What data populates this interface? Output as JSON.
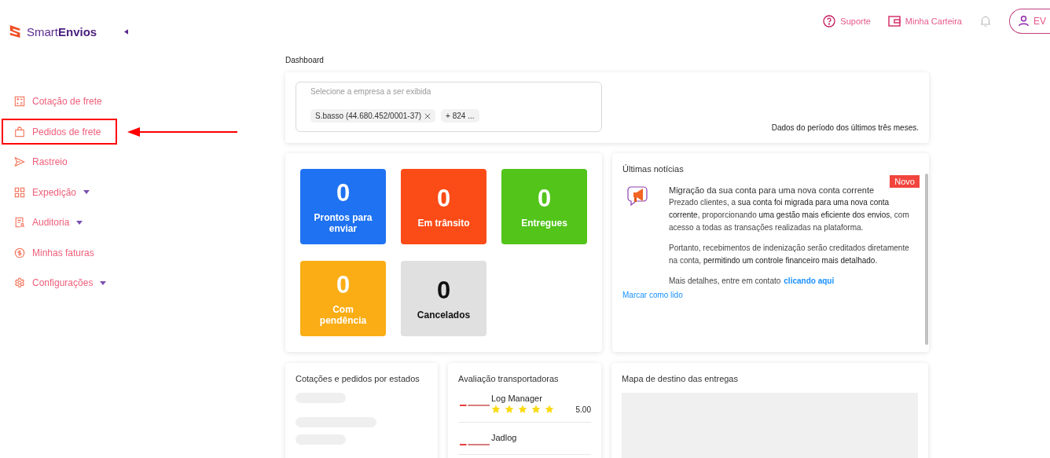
{
  "brand": {
    "name_light": "Smart",
    "name_bold": "Envios"
  },
  "header": {
    "support": "Suporte",
    "wallet": "Minha Carteira",
    "avatar": "EV"
  },
  "sidebar": {
    "items": [
      {
        "label": "Cotação de frete",
        "has_submenu": false,
        "highlighted": false
      },
      {
        "label": "Pedidos de frete",
        "has_submenu": false,
        "highlighted": true
      },
      {
        "label": "Rastreio",
        "has_submenu": false,
        "highlighted": false
      },
      {
        "label": "Expedição",
        "has_submenu": true,
        "highlighted": false
      },
      {
        "label": "Auditoria",
        "has_submenu": true,
        "highlighted": false
      },
      {
        "label": "Minhas faturas",
        "has_submenu": false,
        "highlighted": false
      },
      {
        "label": "Configurações",
        "has_submenu": true,
        "highlighted": false
      }
    ]
  },
  "breadcrumb": "Dashboard",
  "filter": {
    "placeholder": "Selecione a empresa a ser exibida",
    "tags": [
      {
        "label": "S.basso (44.680.452/0001-37)",
        "removable": true
      },
      {
        "label": "+ 824 ...",
        "removable": false
      }
    ],
    "period_note": "Dados do período dos últimos três meses."
  },
  "stats": [
    {
      "value": "0",
      "label": "Prontos para enviar",
      "color": "#1f72f1"
    },
    {
      "value": "0",
      "label": "Em trânsito",
      "color": "#fb4b17"
    },
    {
      "value": "0",
      "label": "Entregues",
      "color": "#52c41a"
    },
    {
      "value": "0",
      "label": "Com pendência",
      "color": "#faad14"
    },
    {
      "value": "0",
      "label": "Cancelados",
      "color": "#e0e0e0"
    }
  ],
  "news": {
    "title": "Últimas notícias",
    "badge": "Novo",
    "headline": "Migração da sua conta para uma nova conta corrente",
    "paragraphs": [
      "Prezado clientes, a **sua conta foi migrada para uma nova conta corrente**, proporcionando **uma gestão mais eficiente dos envios**, com acesso a todas as transações realizadas na plataforma.",
      "Portanto, recebimentos de indenização serão creditados diretamente na conta, **permitindo um controle financeiro mais detalhado**."
    ],
    "contact_text": "Mais detalhes, entre em contato",
    "contact_link": "clicando aqui",
    "mark_read": "Marcar como lido"
  },
  "states_card": {
    "title": "Cotações e pedidos por estados"
  },
  "carriers": {
    "title": "Avaliação transportadoras",
    "items": [
      {
        "name": "Log Manager",
        "stars": 5,
        "score": "5.00"
      },
      {
        "name": "Jadlog"
      }
    ]
  },
  "map_card": {
    "title": "Mapa de destino das entregas"
  }
}
